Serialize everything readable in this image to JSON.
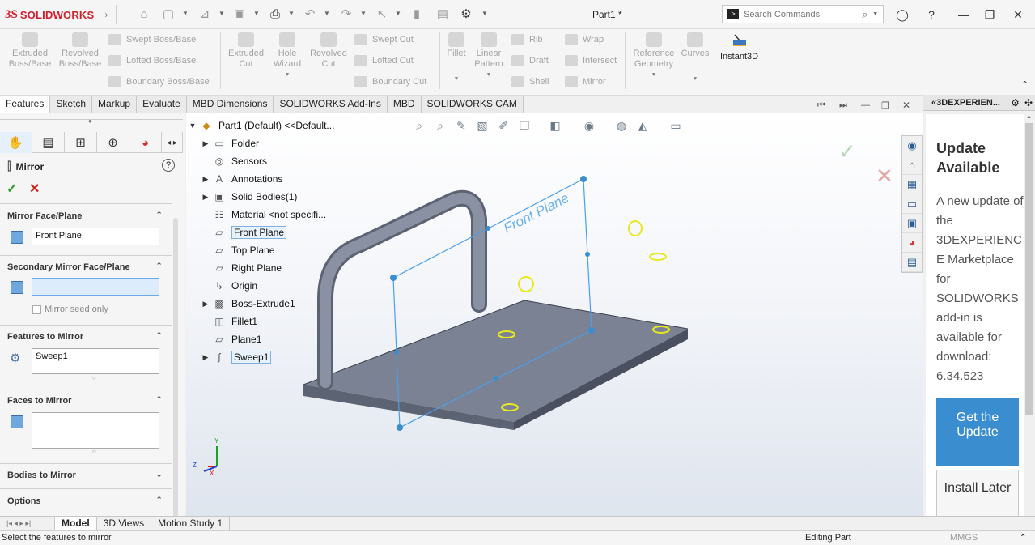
{
  "app": {
    "logo_mark": "3S",
    "logo_text": "SOLIDWORKS",
    "document_title": "Part1 *"
  },
  "search": {
    "placeholder": "Search Commands"
  },
  "command_manager": {
    "extruded_boss": "Extruded\nBoss/Base",
    "revolved_boss": "Revolved\nBoss/Base",
    "swept_boss": "Swept Boss/Base",
    "lofted_boss": "Lofted Boss/Base",
    "boundary_boss": "Boundary Boss/Base",
    "extruded_cut": "Extruded\nCut",
    "hole_wizard": "Hole\nWizard",
    "revolved_cut": "Revolved\nCut",
    "swept_cut": "Swept Cut",
    "lofted_cut": "Lofted Cut",
    "boundary_cut": "Boundary Cut",
    "fillet": "Fillet",
    "linear_pattern": "Linear\nPattern",
    "rib": "Rib",
    "draft": "Draft",
    "shell": "Shell",
    "wrap": "Wrap",
    "intersect": "Intersect",
    "mirror": "Mirror",
    "reference_geometry": "Reference\nGeometry",
    "curves": "Curves",
    "instant3d": "Instant3D"
  },
  "tabs": [
    "Features",
    "Sketch",
    "Markup",
    "Evaluate",
    "MBD Dimensions",
    "SOLIDWORKS Add-Ins",
    "MBD",
    "SOLIDWORKS CAM"
  ],
  "property_manager": {
    "title": "Mirror",
    "help": "?",
    "ok": "✓",
    "cancel": "✕",
    "sections": {
      "mirror_face_plane": "Mirror Face/Plane",
      "mirror_face_value": "Front Plane",
      "secondary_mirror": "Secondary Mirror Face/Plane",
      "secondary_value": "",
      "mirror_seed_only": "Mirror seed only",
      "features_to_mirror": "Features to Mirror",
      "features_value": "Sweep1",
      "faces_to_mirror": "Faces to Mirror",
      "bodies_to_mirror": "Bodies to Mirror",
      "options": "Options"
    }
  },
  "feature_tree": {
    "root": "Part1 (Default) <<Default...",
    "items": [
      {
        "label": "Folder",
        "expandable": true
      },
      {
        "label": "Sensors",
        "expandable": false
      },
      {
        "label": "Annotations",
        "expandable": true
      },
      {
        "label": "Solid Bodies(1)",
        "expandable": true
      },
      {
        "label": "Material <not specifi...",
        "expandable": false
      },
      {
        "label": "Front Plane",
        "expandable": false
      },
      {
        "label": "Top Plane",
        "expandable": false
      },
      {
        "label": "Right Plane",
        "expandable": false
      },
      {
        "label": "Origin",
        "expandable": false
      },
      {
        "label": "Boss-Extrude1",
        "expandable": true
      },
      {
        "label": "Fillet1",
        "expandable": false
      },
      {
        "label": "Plane1",
        "expandable": false
      },
      {
        "label": "Sweep1",
        "expandable": true
      }
    ]
  },
  "viewport": {
    "plane_label": "Front Plane",
    "triad": {
      "x": "X",
      "y": "Y",
      "z": "Z"
    }
  },
  "task_pane": {
    "header": "3DEXPERIEN...",
    "heading": "Update Available",
    "body": "A new update of the 3DEXPERIENCE Marketplace for SOLIDWORKS add-in is available for download: 6.34.523",
    "primary_button": "Get the Update",
    "secondary_button": "Install Later"
  },
  "bottom_tabs": [
    "Model",
    "3D Views",
    "Motion Study 1"
  ],
  "status": {
    "message": "Select the features to mirror",
    "mode": "Editing Part",
    "units": "MMGS"
  },
  "colors": {
    "brand": "#d0202e",
    "accent": "#3a8ed0",
    "part": "#7b8294"
  }
}
